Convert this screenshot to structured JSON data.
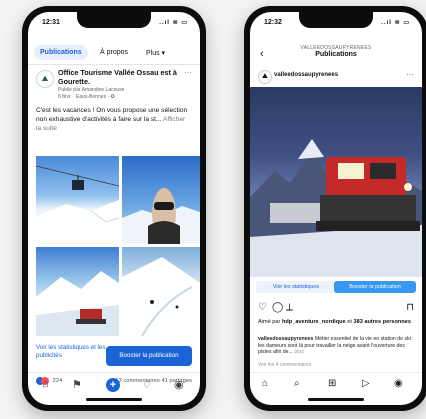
{
  "left_phone": {
    "status": {
      "time": "12:31",
      "icons": "..ıl ≋ ▭"
    },
    "tabs": [
      {
        "label": "Publications",
        "active": true
      },
      {
        "label": "À propos",
        "active": false
      },
      {
        "label": "Plus ▾",
        "active": false
      }
    ],
    "post": {
      "author": "Office Tourisme Vallée Ossau est à Gourette.",
      "published_by": "Publié par Amandine Lacouse",
      "meta": "6 févr. · Eaux-Bonnes · ✪",
      "text": "C'est les vacances ! On vous propose une sélection non exhaustive d'activités à faire sur la st...",
      "see_more": "Afficher la suite",
      "more_icon": "···"
    },
    "actions": {
      "stats_link": "Voir les statistiques et les publicités",
      "boost_button": "Booster la publication"
    },
    "reactions": {
      "count": "224",
      "comments_shares": "13 commentaires 41 partages"
    },
    "nav_icons": [
      "home-icon",
      "flag-icon",
      "add-icon",
      "notification-icon",
      "profile-icon"
    ],
    "nav_glyphs": [
      "⌂",
      "⚑",
      "+",
      "♢",
      "◉"
    ]
  },
  "right_phone": {
    "status": {
      "time": "12:32",
      "icons": "..ıl ≋ ▭"
    },
    "header": {
      "back": "‹",
      "username_small": "VALLEEDOSSAUPYRENEES",
      "title": "Publications"
    },
    "author": {
      "name": "valleedossaupyrenees",
      "dots": "···"
    },
    "buttons": {
      "stats": "Voir les statistiques",
      "boost": "Booster la publication"
    },
    "action_icons": [
      "heart-icon",
      "comment-icon",
      "share-icon",
      "bookmark-icon"
    ],
    "action_glyphs": [
      "♡",
      "◯",
      "⟂",
      "⊓"
    ],
    "likes": {
      "prefix": "Aimé par",
      "user": "hdp_aventure_nordique",
      "suffix": "et",
      "others": "383 autres personnes"
    },
    "caption": {
      "user": "valleedossaupyrenees",
      "text": "Métier essentiel de la vie en station de ski : les dameurs sont là pour travailler la neige avant l'ouverture des pistes afin de...",
      "more": "plus"
    },
    "comments": "Voir les 4 commentaires",
    "nav_icons": [
      "home-icon",
      "search-icon",
      "add-post-icon",
      "reels-icon",
      "profile-icon"
    ],
    "nav_glyphs": [
      "⌂",
      "⌕",
      "⊞",
      "▷",
      "◉"
    ]
  }
}
